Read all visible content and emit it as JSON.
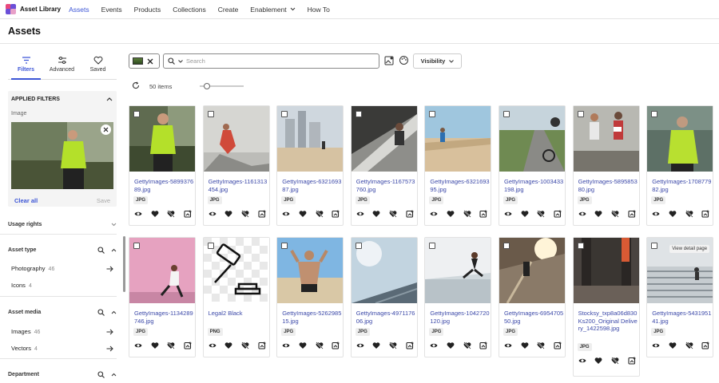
{
  "app": {
    "brand": "Asset Library",
    "nav": [
      {
        "label": "Assets",
        "active": true
      },
      {
        "label": "Events"
      },
      {
        "label": "Products"
      },
      {
        "label": "Collections"
      },
      {
        "label": "Create"
      },
      {
        "label": "Enablement",
        "dropdown": true
      },
      {
        "label": "How To"
      }
    ]
  },
  "page": {
    "title": "Assets"
  },
  "sidebar": {
    "tabs": [
      {
        "label": "Filters",
        "icon": "filter-icon",
        "active": true
      },
      {
        "label": "Advanced",
        "icon": "sliders-icon"
      },
      {
        "label": "Saved",
        "icon": "heart-icon"
      }
    ],
    "applied": {
      "title": "APPLIED FILTERS",
      "image_label": "Image",
      "clear": "Clear all",
      "save": "Save"
    },
    "sections": [
      {
        "title": "Usage rights",
        "rows": []
      },
      {
        "title": "Asset type",
        "rows": [
          {
            "label": "Photography",
            "count": "46"
          },
          {
            "label": "Icons",
            "count": "4"
          }
        ]
      },
      {
        "title": "Asset media",
        "rows": [
          {
            "label": "Images",
            "count": "46"
          },
          {
            "label": "Vectors",
            "count": "4"
          }
        ]
      },
      {
        "title": "Department",
        "rows": []
      }
    ]
  },
  "toolbar": {
    "search_placeholder": "Search",
    "visibility": "Visibility"
  },
  "results": {
    "count": "50 items"
  },
  "tooltip": "View detail page",
  "assets": [
    {
      "name": "GettyImages-589937689.jpg",
      "type": "JPG",
      "art": "jacket"
    },
    {
      "name": "GettyImages-1161313454.jpg",
      "type": "JPG",
      "art": "wall"
    },
    {
      "name": "GettyImages-632169387.jpg",
      "type": "JPG",
      "art": "city"
    },
    {
      "name": "GettyImages-1167573760.jpg",
      "type": "JPG",
      "art": "track"
    },
    {
      "name": "GettyImages-632169395.jpg",
      "type": "JPG",
      "art": "beach"
    },
    {
      "name": "GettyImages-1003433198.jpg",
      "type": "JPG",
      "art": "road"
    },
    {
      "name": "GettyImages-589585380.jpg",
      "type": "JPG",
      "art": "race"
    },
    {
      "name": "GettyImages-170877982.jpg",
      "type": "JPG",
      "art": "jacket2"
    },
    {
      "name": "GettyImages-1134289746.jpg",
      "type": "JPG",
      "art": "pink"
    },
    {
      "name": "Legal2 Black",
      "type": "PNG",
      "art": "gavel"
    },
    {
      "name": "GettyImages-526298515.jpg",
      "type": "JPG",
      "art": "flex"
    },
    {
      "name": "GettyImages-497117606.jpg",
      "type": "JPG",
      "art": "sky"
    },
    {
      "name": "GettyImages-1042720120.jpg",
      "type": "JPG",
      "art": "jump"
    },
    {
      "name": "GettyImages-695470550.jpg",
      "type": "JPG",
      "art": "sun"
    },
    {
      "name": "Stocksy_txp8a06d830Ks200_Original Delivery_1422598.jpg",
      "type": "JPG",
      "art": "tread"
    },
    {
      "name": "GettyImages-543195141.jpg",
      "type": "JPG",
      "art": "stairs"
    }
  ],
  "colors": {
    "accent": "#3c55d6",
    "link": "#3b48a8"
  }
}
